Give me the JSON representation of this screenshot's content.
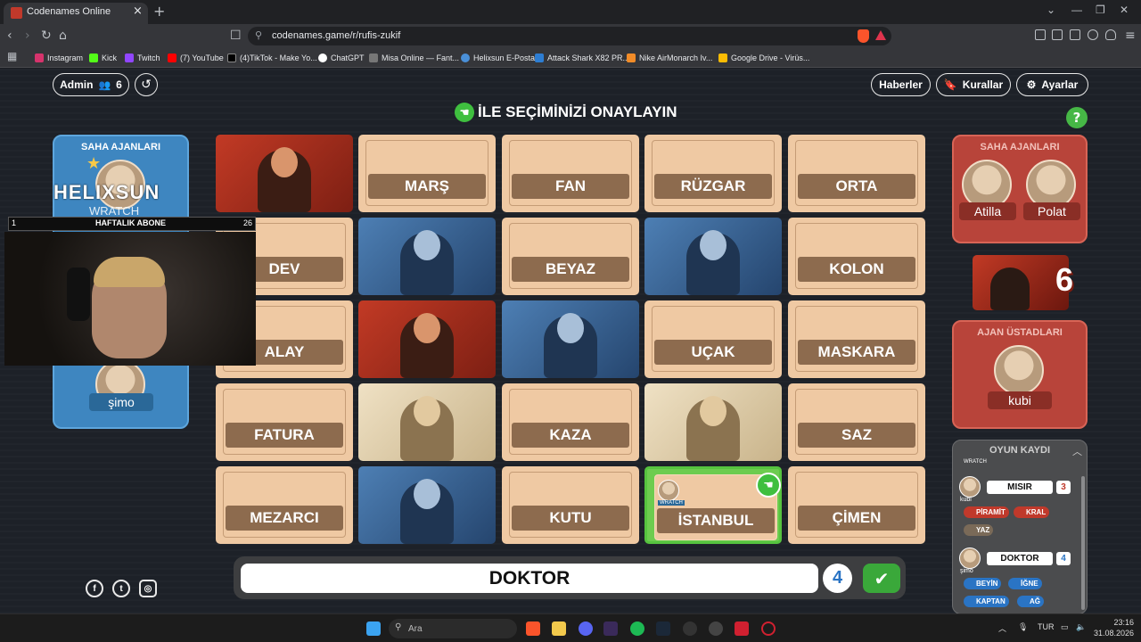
{
  "browser": {
    "tab_title": "Codenames Online",
    "url": "codenames.game/r/rufis-zukif",
    "bookmarks": [
      {
        "label": "Instagram",
        "color": "#d6336c"
      },
      {
        "label": "Kick",
        "color": "#53fc18"
      },
      {
        "label": "Twitch",
        "color": "#9146ff"
      },
      {
        "label": "(7) YouTube",
        "color": "#ff0000"
      },
      {
        "label": "(4)TikTok - Make Yo...",
        "color": "#000000"
      },
      {
        "label": "ChatGPT",
        "color": "#ffffff"
      },
      {
        "label": "Misa Online — Fant...",
        "color": "#777777"
      },
      {
        "label": "Helixsun E-Posta",
        "color": "#4a90d9"
      },
      {
        "label": "Attack Shark X82 PR...",
        "color": "#2d7dd2"
      },
      {
        "label": "Nike AirMonarch Iv...",
        "color": "#f28c28"
      },
      {
        "label": "Google Drive - Virüs...",
        "color": "#fbbc04"
      }
    ]
  },
  "header": {
    "admin_label": "Admin",
    "player_count": "6",
    "news_label": "Haberler",
    "rules_label": "Kurallar",
    "settings_label": "Ayarlar"
  },
  "headline": "İLE SEÇİMİNİZİ ONAYLAYIN",
  "blue_team": {
    "operatives_title": "SAHA AJANLARI",
    "spymaster_name": "şimo"
  },
  "red_team": {
    "operatives_title": "SAHA AJANLARI",
    "operatives": [
      "Atilla",
      "Polat"
    ],
    "remaining": "6",
    "spymasters_title": "AJAN ÜSTADLARI",
    "spymaster": "kubi"
  },
  "overlay": {
    "sponsor_text": "HELIXSUN",
    "sponsor_sub": "WRATCH",
    "sub_start": "1",
    "sub_goal_label": "HAFTALIK ABONE",
    "sub_end": "26"
  },
  "cards": [
    {
      "type": "red-agent",
      "word": ""
    },
    {
      "type": "word",
      "word": "MARŞ"
    },
    {
      "type": "word",
      "word": "FAN"
    },
    {
      "type": "word",
      "word": "RÜZGAR"
    },
    {
      "type": "word",
      "word": "ORTA"
    },
    {
      "type": "word",
      "word": "DEV"
    },
    {
      "type": "blue-agent",
      "word": ""
    },
    {
      "type": "word",
      "word": "BEYAZ"
    },
    {
      "type": "blue-agent",
      "word": ""
    },
    {
      "type": "word",
      "word": "KOLON"
    },
    {
      "type": "word",
      "word": "ALAY"
    },
    {
      "type": "red-agent",
      "word": ""
    },
    {
      "type": "blue-agent",
      "word": ""
    },
    {
      "type": "word",
      "word": "UÇAK"
    },
    {
      "type": "word",
      "word": "MASKARA"
    },
    {
      "type": "word",
      "word": "FATURA"
    },
    {
      "type": "neutral",
      "word": ""
    },
    {
      "type": "word",
      "word": "KAZA"
    },
    {
      "type": "neutral",
      "word": ""
    },
    {
      "type": "word",
      "word": "SAZ"
    },
    {
      "type": "word",
      "word": "MEZARCI"
    },
    {
      "type": "blue-agent",
      "word": ""
    },
    {
      "type": "word",
      "word": "KUTU"
    },
    {
      "type": "selected",
      "word": "İSTANBUL",
      "picker": "WRATCH"
    },
    {
      "type": "word",
      "word": "ÇİMEN"
    }
  ],
  "clue": {
    "word": "DOKTOR",
    "number": "4"
  },
  "log": {
    "title": "OYUN KAYDI",
    "top_player": "WRATCH",
    "entries": [
      {
        "player": "kubi",
        "clue": "MISIR",
        "number": "3",
        "team": "red",
        "guesses": [
          {
            "word": "PİRAMİT"
          },
          {
            "word": "KRAL"
          },
          {
            "word": "YAZ"
          }
        ]
      },
      {
        "player": "şimo",
        "clue": "DOKTOR",
        "number": "4",
        "team": "blue",
        "guesses": [
          {
            "word": "BEYİN"
          },
          {
            "word": "İĞNE"
          },
          {
            "word": "KAPTAN"
          },
          {
            "word": "AĞ"
          }
        ]
      }
    ]
  },
  "taskbar": {
    "search_placeholder": "Ara",
    "lang": "TUR",
    "time": "23:16",
    "date": "31.08.2026"
  }
}
